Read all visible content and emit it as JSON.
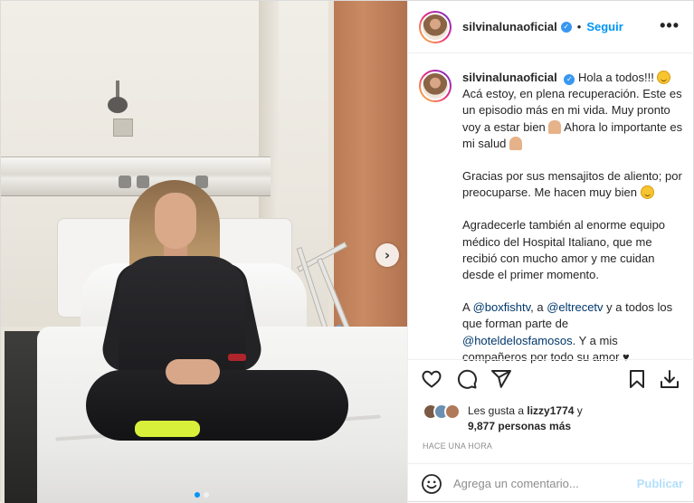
{
  "header": {
    "username": "silvinalunaoficial",
    "verified_mark": "✓",
    "separator": "•",
    "follow_label": "Seguir",
    "more_label": "•••"
  },
  "photo": {
    "next_arrow": "›",
    "slide_count": 2,
    "active_slide": 1
  },
  "caption": {
    "username": "silvinalunaoficial",
    "paragraph1_a": " Hola a todos!!! ",
    "paragraph1_b": " Acá estoy, en plena recuperación. Este es un episodio más en mi vida. Muy pronto voy a estar bien ",
    "paragraph1_c": " Ahora lo importante es mi salud ",
    "paragraph2_a": "Gracias por sus mensajitos de aliento; por preocuparse. Me hacen muy bien ",
    "paragraph3": "Agradecerle también al enorme equipo médico del Hospital Italiano, que me recibió con mucho amor y me cuidan desde el primer momento.",
    "paragraph4_a": "A ",
    "mention1": "@boxfishtv",
    "paragraph4_b": ", a ",
    "mention2": "@eltrecetv",
    "paragraph4_c": " y a todos los que forman parte de ",
    "mention3": "@hoteldelosfamosos",
    "paragraph4_d": ". Y a mis compañeros por todo su amor ♥",
    "emojis": [
      "smiling-face",
      "flexed-biceps",
      "folded-hands",
      "smiling-face"
    ]
  },
  "actions": {
    "icons": [
      "heart-icon",
      "comment-icon",
      "share-icon",
      "bookmark-icon",
      "download-icon"
    ]
  },
  "likes": {
    "prefix": "Les gusta a ",
    "user": "lizzy1774",
    "middle": " y",
    "count": "9,877 personas más"
  },
  "timestamp": "HACE UNA HORA",
  "comment": {
    "placeholder": "Agrega un comentario...",
    "publish_label": "Publicar"
  },
  "colors": {
    "accent": "#0095f6",
    "mention": "#00376b",
    "muted": "#8e8e8e",
    "publish_disabled": "#b2dffc"
  }
}
